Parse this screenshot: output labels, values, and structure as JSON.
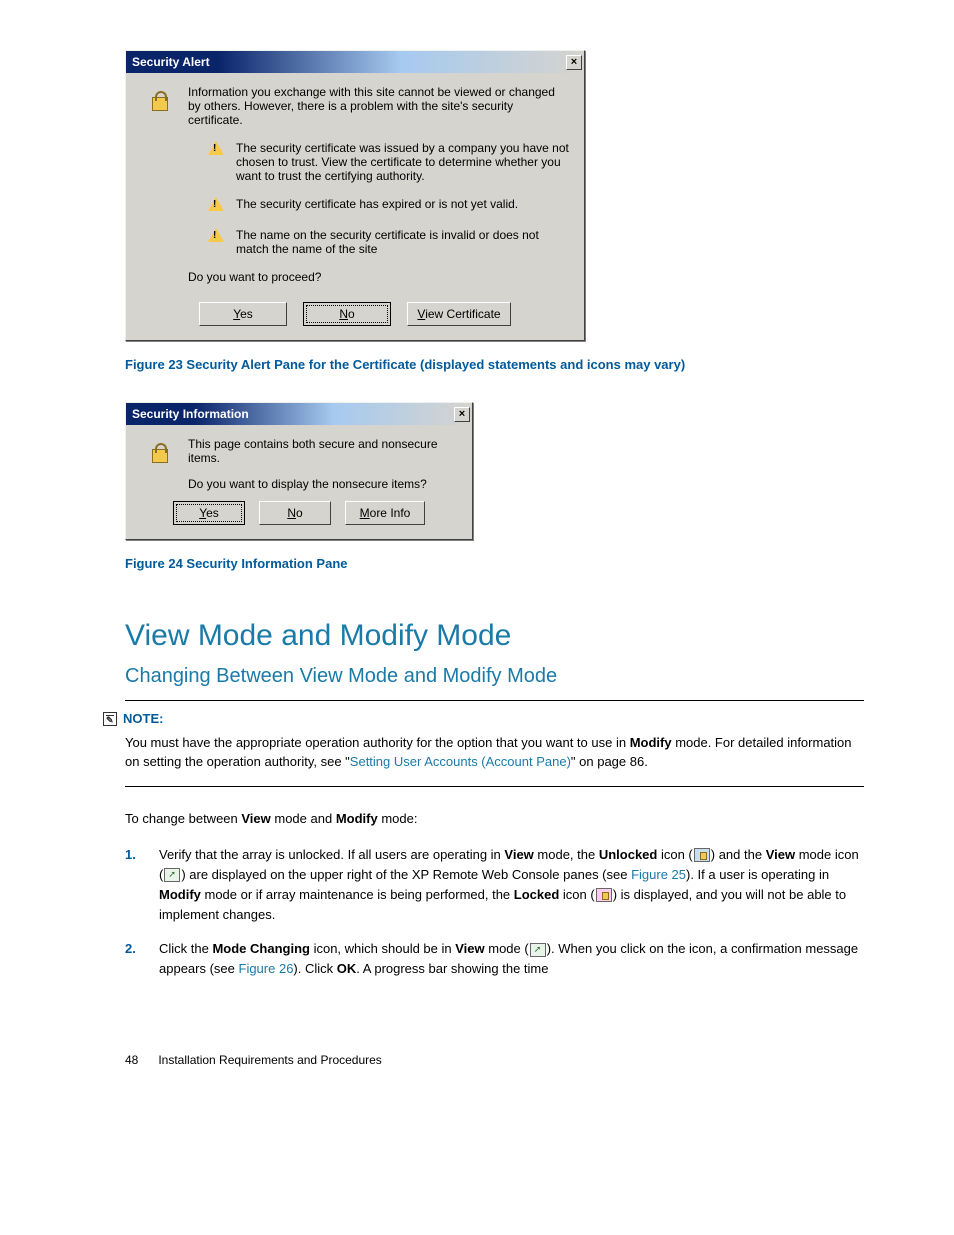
{
  "dialog1": {
    "title": "Security Alert",
    "intro": "Information you exchange with this site cannot be viewed or changed by others. However, there is a problem with the site's security certificate.",
    "points": [
      "The security certificate was issued by a company you have not chosen to trust. View the certificate to determine whether you want to trust the certifying authority.",
      "The security certificate has expired or is not yet valid.",
      "The name on the security certificate is invalid or does not match the name of the site"
    ],
    "proceed": "Do you want to proceed?",
    "buttons": {
      "yes": "Yes",
      "no": "No",
      "viewcert": "View Certificate"
    }
  },
  "caption1": "Figure 23 Security Alert Pane for the Certificate (displayed statements and icons may vary)",
  "dialog2": {
    "title": "Security Information",
    "line1": "This page contains both secure and nonsecure items.",
    "line2": "Do you want to display the nonsecure items?",
    "buttons": {
      "yes": "Yes",
      "no": "No",
      "more": "More Info"
    }
  },
  "caption2": "Figure 24 Security Information Pane",
  "h1": "View Mode and Modify Mode",
  "h2": "Changing Between View Mode and Modify Mode",
  "note": {
    "label": "NOTE:",
    "text_pre": "You must have the appropriate operation authority for the option that you want to use in ",
    "bold1": "Modify",
    "text_mid": " mode. For detailed information on setting the operation authority, see \"",
    "link": "Setting User Accounts (Account Pane)",
    "text_post": "\" on page 86."
  },
  "intro": {
    "pre": "To change between ",
    "b1": "View",
    "mid": " mode and ",
    "b2": "Modify",
    "post": " mode:"
  },
  "steps": {
    "s1": {
      "a": "Verify that the array is unlocked. If all users are operating in ",
      "b_view": "View",
      "b": " mode, the ",
      "b_unlocked": "Unlocked",
      "c": " icon (",
      "d": ") and the ",
      "b_view2": "View",
      "e": " mode icon (",
      "f": ") are displayed on the upper right of the XP Remote Web Console panes (see ",
      "link": "Figure 25",
      "g": "). If a user is operating in ",
      "b_modify": "Modify",
      "h": " mode or if array maintenance is being performed, the ",
      "b_locked": "Locked",
      "i": " icon (",
      "j": ") is displayed, and you will not be able to implement changes."
    },
    "s2": {
      "a": "Click the ",
      "b_mode": "Mode Changing",
      "b": " icon, which should be in ",
      "b_view": "View",
      "c": " mode (",
      "d": "). When you click on the icon, a confirmation message appears (see ",
      "link": "Figure 26",
      "e": "). Click ",
      "b_ok": "OK",
      "f": ". A progress bar showing the time"
    }
  },
  "footer": {
    "page": "48",
    "section": "Installation Requirements and Procedures"
  }
}
